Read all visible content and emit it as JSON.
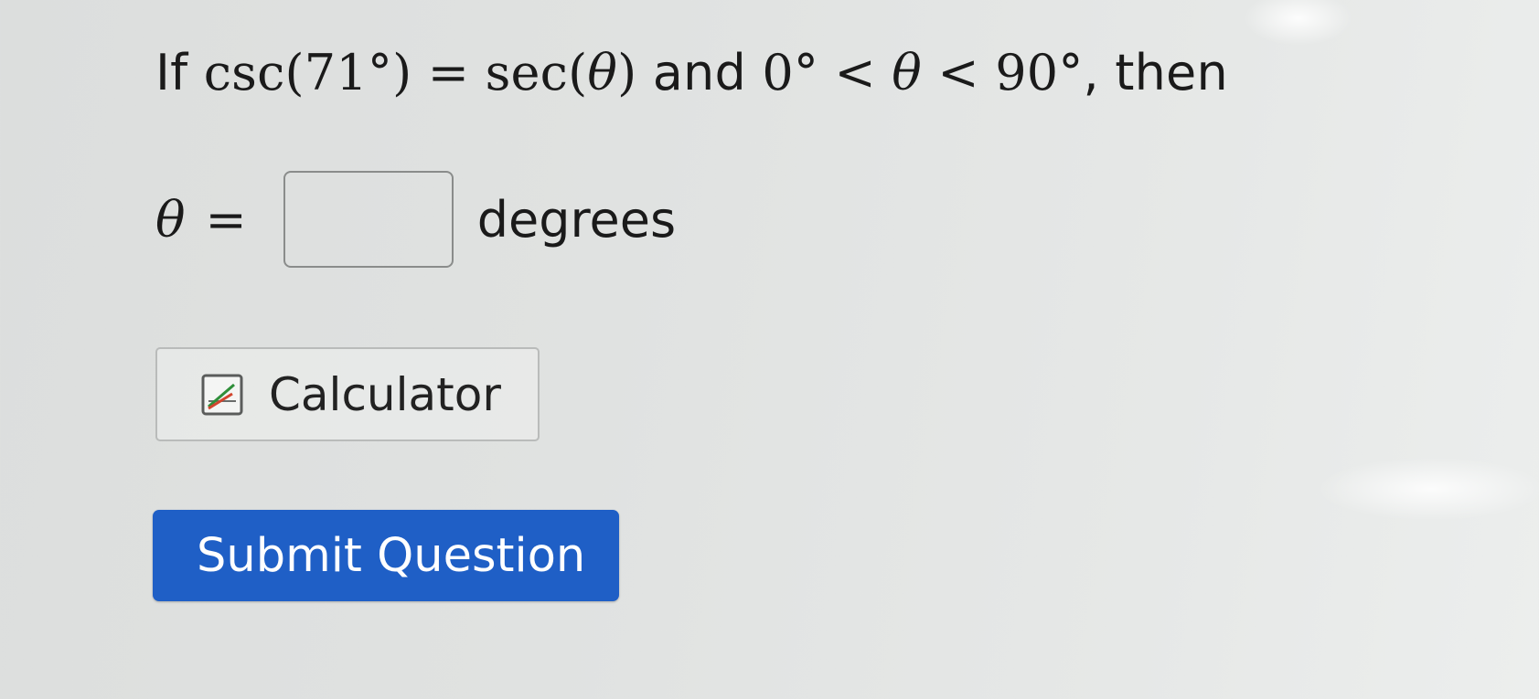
{
  "question": {
    "prefix": "If",
    "csc_expr": "csc(71°)",
    "equals": "=",
    "sec_expr_start": "sec(",
    "theta": "θ",
    "sec_expr_end": ")",
    "conjunction": "and",
    "lower_bound": "0°",
    "less_than": "<",
    "upper_bound": "90°",
    "suffix": ", then"
  },
  "answer": {
    "variable": "θ",
    "equals": "=",
    "value": "",
    "unit": "degrees"
  },
  "calculator_button": {
    "label": "Calculator",
    "icon": "calculator-graph-icon"
  },
  "submit_button": {
    "label": "Submit Question",
    "color": "#1f5fc6"
  }
}
